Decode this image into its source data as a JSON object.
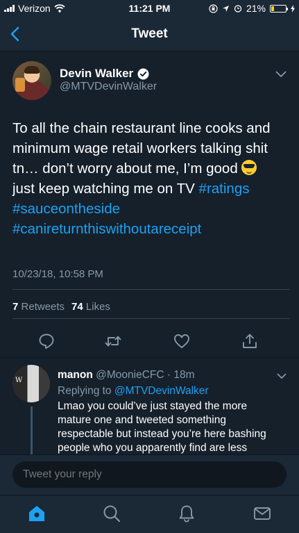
{
  "status_bar": {
    "carrier": "Verizon",
    "time": "11:21 PM",
    "battery_percent": "21%",
    "battery_level": 0.21,
    "battery_color": "#ffd60a",
    "icons": [
      "signal-icon",
      "wifi-icon",
      "orientation-lock-icon",
      "location-icon",
      "alarm-icon",
      "battery-icon",
      "charging-icon"
    ]
  },
  "nav": {
    "title": "Tweet",
    "back_icon": "chevron-left-icon"
  },
  "tweet": {
    "author_name": "Devin Walker",
    "verified": true,
    "handle": "@MTVDevinWalker",
    "text_lines": [
      {
        "text": "To all the chain restaurant line cooks and"
      },
      {
        "text": "minimum wage retail workers talking shit"
      },
      {
        "text": "tn… don’t worry about me, I’m good"
      },
      {
        "text": "just keep watching me on TV ",
        "hashtag": "#ratings"
      },
      {
        "hashtag": "#sauceontheside"
      },
      {
        "hashtag": "#canireturnthiswithoutareceipt"
      }
    ],
    "timestamp": "10/23/18, 10:58 PM",
    "retweets_count": "7",
    "retweets_label": "Retweets",
    "likes_count": "74",
    "likes_label": "Likes",
    "action_icons": [
      "reply-icon",
      "retweet-icon",
      "like-icon",
      "share-icon"
    ]
  },
  "reply": {
    "author_name": "manon",
    "handle": "@MoonieCFC",
    "separator": "·",
    "age": "18m",
    "replying_to_label": "Replying to",
    "replying_to_handle": "@MTVDevinWalker",
    "text_lines": [
      "Lmao you could’ve just stayed the more",
      "mature one and tweeted something",
      "respectable but instead you’re here bashing",
      "people who you apparently find are less"
    ],
    "avatar_letter": "W"
  },
  "compose": {
    "placeholder": "Tweet your reply"
  },
  "tabs": [
    {
      "icon": "home-icon",
      "active": true
    },
    {
      "icon": "search-icon",
      "active": false
    },
    {
      "icon": "notifications-icon",
      "active": false
    },
    {
      "icon": "messages-icon",
      "active": false
    }
  ],
  "colors": {
    "background": "#15202b",
    "bar_background": "#1b2836",
    "accent": "#1da1f2",
    "secondary_text": "#8899a6"
  }
}
